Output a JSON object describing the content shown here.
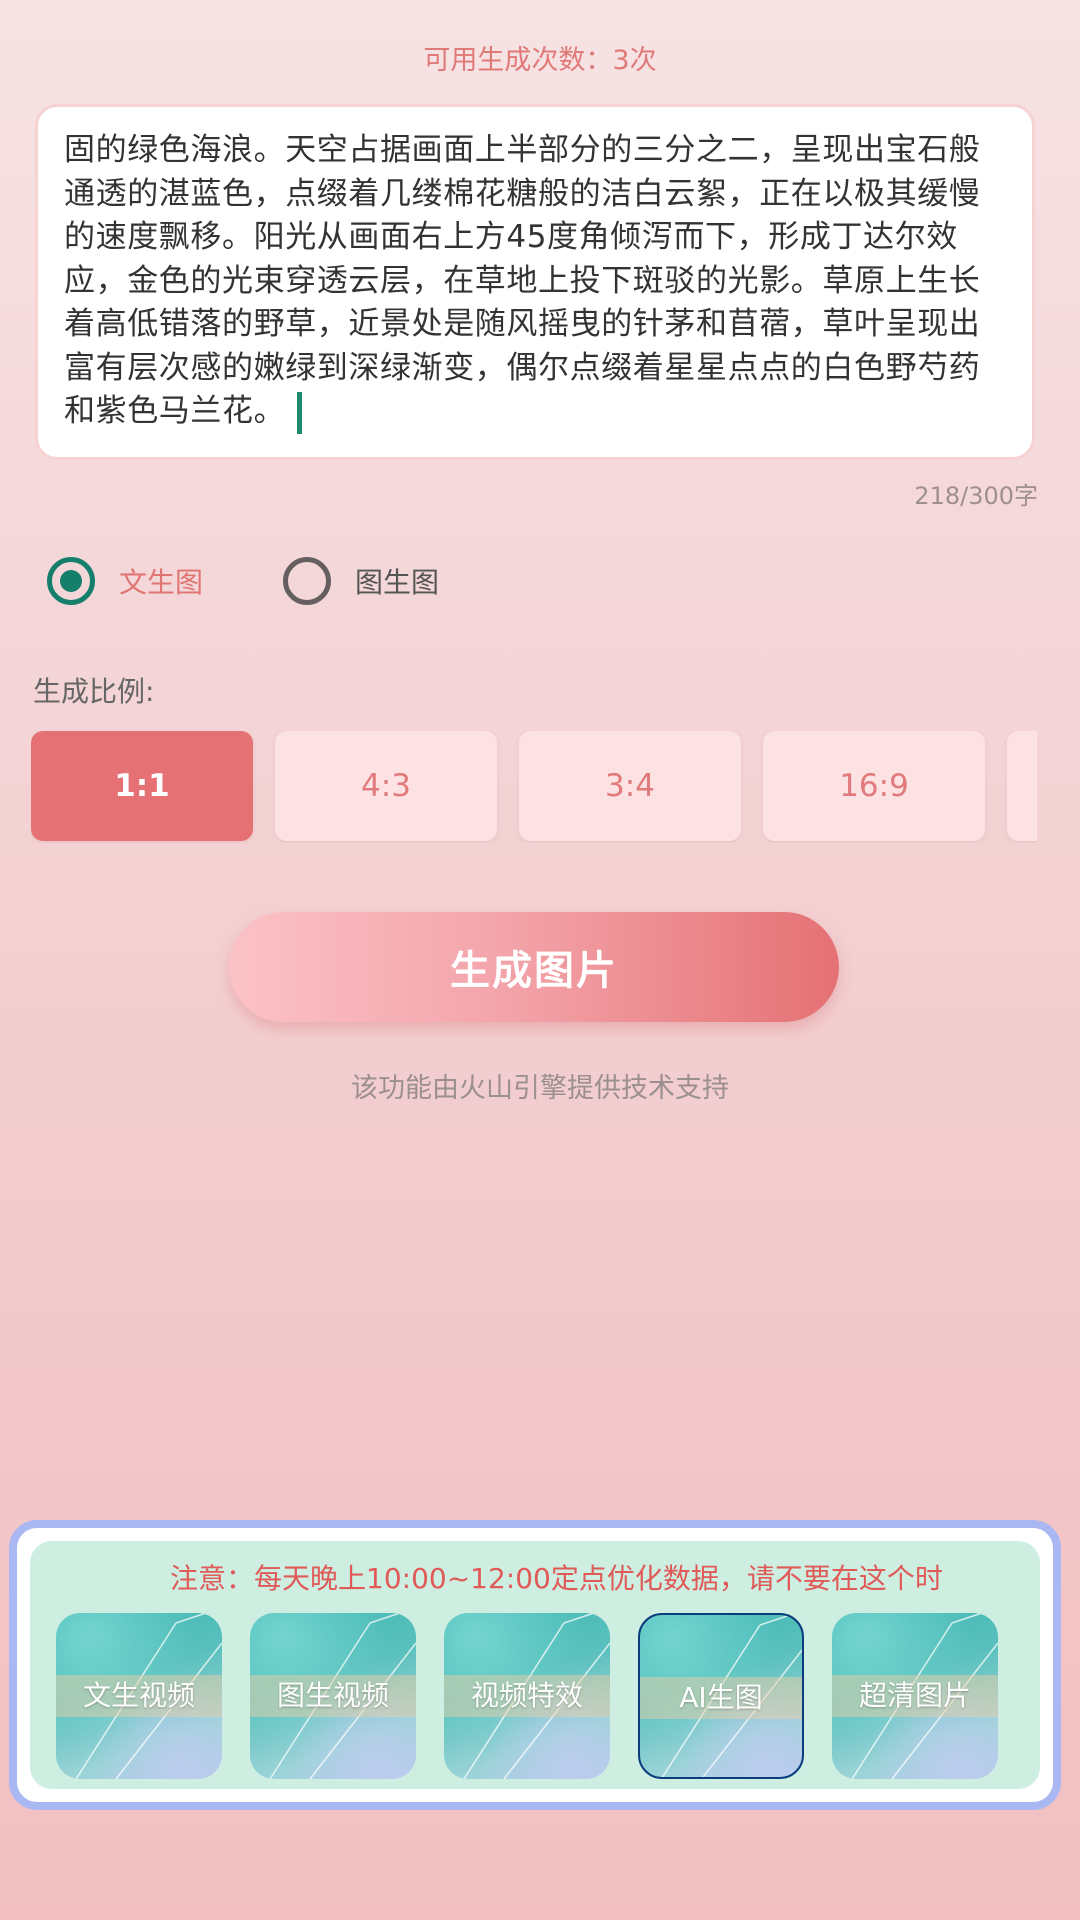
{
  "quota_text": "可用生成次数：3次",
  "prompt": {
    "text": "固的绿色海浪。天空占据画面上半部分的三分之二，呈现出宝石般通透的湛蓝色，点缀着几缕棉花糖般的洁白云絮，正在以极其缓慢的速度飘移。阳光从画面右上方45度角倾泻而下，形成丁达尔效应，金色的光束穿透云层，在草地上投下斑驳的光影。草原上生长着高低错落的野草，近景处是随风摇曳的针茅和苜蓿，草叶呈现出富有层次感的嫩绿到深绿渐变，偶尔点缀着星星点点的白色野芍药和紫色马兰花。",
    "char_count": "218/300字"
  },
  "modes": [
    {
      "label": "文生图",
      "checked": true
    },
    {
      "label": "图生图",
      "checked": false
    }
  ],
  "ratio": {
    "title": "生成比例:",
    "options": [
      "1:1",
      "4:3",
      "3:4",
      "16:9"
    ],
    "selected": "1:1"
  },
  "generate_button": "生成图片",
  "powered_by": "该功能由火山引擎提供技术支持",
  "bottom_panel": {
    "notice": "注意：每天晚上10:00~12:00定点优化数据，请不要在这个时",
    "features": [
      {
        "label": "文生视频"
      },
      {
        "label": "图生视频"
      },
      {
        "label": "视频特效"
      },
      {
        "label": "AI生图",
        "active": true
      },
      {
        "label": "超清图片"
      }
    ]
  },
  "colors": {
    "accent": "#e67174",
    "radio_checked": "#167f6b",
    "cursor": "#1f8a6e",
    "panel_border": "#a9b8f3",
    "panel_inner": "#cdeee1",
    "notice_text": "#e05a58"
  }
}
